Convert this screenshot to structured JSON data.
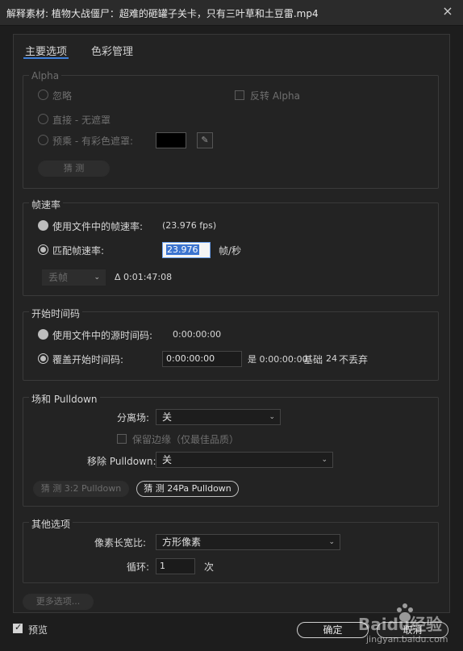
{
  "dialog": {
    "title": "解释素材: 植物大战僵尸：超难的砸罐子关卡，只有三叶草和土豆雷.mp4",
    "close_icon": "×"
  },
  "tabs": {
    "main": "主要选项",
    "color": "色彩管理"
  },
  "alpha": {
    "legend": "Alpha",
    "ignore": "忽略",
    "invert": "反转 Alpha",
    "straight": "直接 - 无遮罩",
    "premult": "预乘 - 有彩色遮罩:",
    "matte_color": "#000000",
    "guess": "猜 测"
  },
  "framerate": {
    "legend": "帧速率",
    "use_file": "使用文件中的帧速率:",
    "file_fps": "(23.976 fps)",
    "conform": "匹配帧速率:",
    "conform_value": "23.976",
    "unit": "帧/秒",
    "drop_label": "丢帧",
    "duration": "Δ 0:01:47:08"
  },
  "timecode": {
    "legend": "开始时间码",
    "use_source": "使用文件中的源时间码:",
    "source_value": "0:00:00:00",
    "override": "覆盖开始时间码:",
    "override_value": "0:00:00:00",
    "is_text": "是 0:00:00:00",
    "base_label": "基础",
    "base_value": "24",
    "drop_text": "不丢弃"
  },
  "fields": {
    "legend": "场和 Pulldown",
    "separate_label": "分离场:",
    "separate_value": "关",
    "preserve_edges": "保留边缘（仅最佳品质）",
    "remove_label": "移除 Pulldown:",
    "remove_value": "关",
    "guess32": "猜 测 3:2 Pulldown",
    "guess24": "猜 测 24Pa Pulldown"
  },
  "other": {
    "legend": "其他选项",
    "par_label": "像素长宽比:",
    "par_value": "方形像素",
    "loop_label": "循环:",
    "loop_value": "1",
    "loop_unit": "次",
    "more": "更多选项..."
  },
  "footer": {
    "preview": "预览",
    "ok": "确定",
    "cancel": "取消"
  },
  "watermark": {
    "brand": "Baidu经验",
    "url": "jingyan.baidu.com"
  }
}
